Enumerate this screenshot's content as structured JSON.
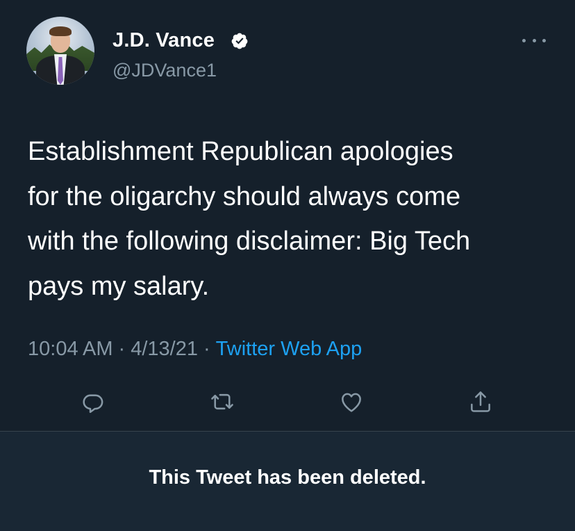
{
  "tweet": {
    "author_name": "J.D. Vance",
    "author_handle": "@JDVance1",
    "verified": true,
    "text": "Establishment Republican apologies\nfor the oligarchy should always come\nwith the following disclaimer: Big Tech\npays my salary.",
    "time": "10:04 AM",
    "separator": "·",
    "date": "4/13/21",
    "source": "Twitter Web App"
  },
  "actions": {
    "reply_icon": "reply-icon",
    "retweet_icon": "retweet-icon",
    "like_icon": "like-icon",
    "share_icon": "share-icon"
  },
  "notice": {
    "text": "This Tweet has been deleted."
  },
  "colors": {
    "background": "#15202b",
    "notice_background": "#192734",
    "secondary_text": "#8899a6",
    "link": "#1da1f2",
    "verified_badge": "#ffffff"
  }
}
